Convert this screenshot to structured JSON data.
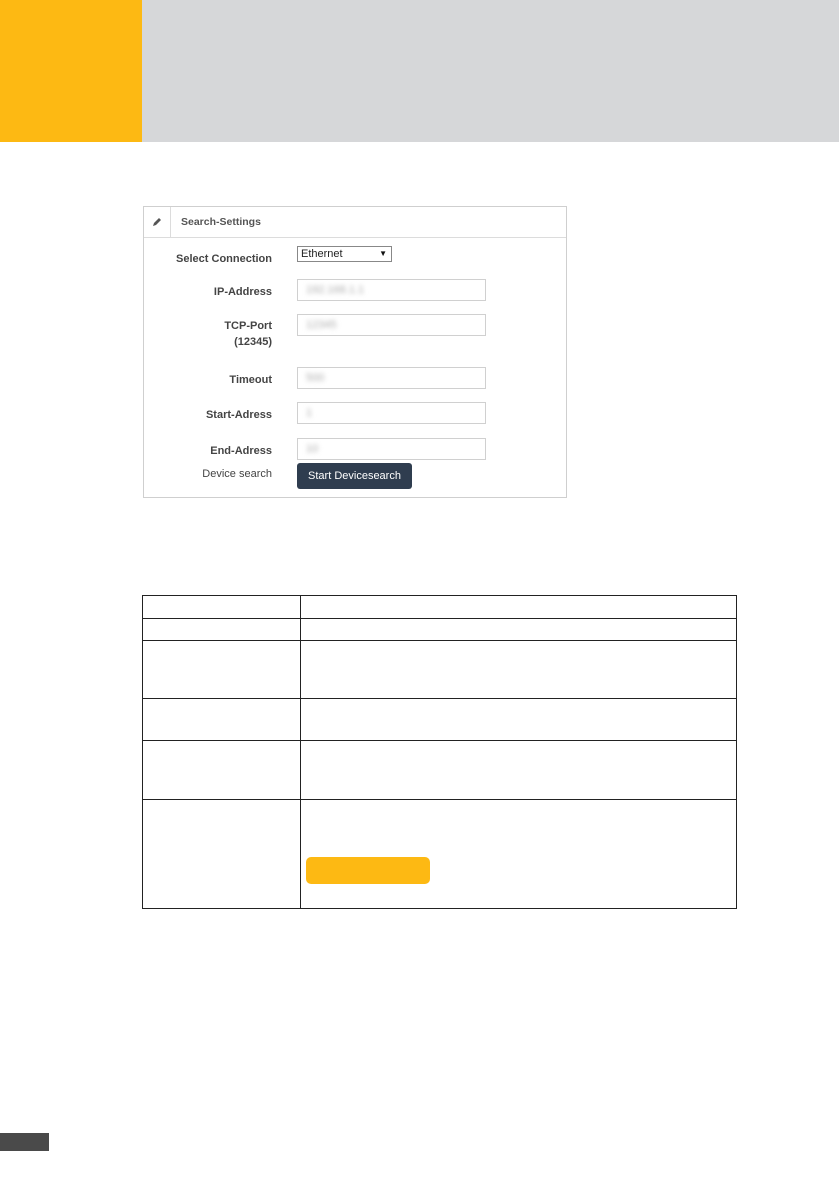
{
  "page": {
    "accent_color": "#fdb913",
    "header_band_color": "#d6d7d9"
  },
  "panel": {
    "title": "Search-Settings",
    "icon": "pencil-icon",
    "fields": [
      {
        "label": "Select Connection",
        "type": "select",
        "value": "Ethernet"
      },
      {
        "label": "IP-Address",
        "type": "input",
        "value": "192.168.1.1"
      },
      {
        "label": "TCP-Port",
        "label_sub": "(12345)",
        "type": "input",
        "value": "12345"
      },
      {
        "label": "Timeout",
        "type": "input",
        "value": "500"
      },
      {
        "label": "Start-Adress",
        "type": "input",
        "value": "1"
      },
      {
        "label": "End-Adress",
        "type": "input",
        "value": "10"
      }
    ],
    "device_search_label": "Device search",
    "search_button": "Start Devicesearch",
    "button_color": "#2f3d4f"
  }
}
